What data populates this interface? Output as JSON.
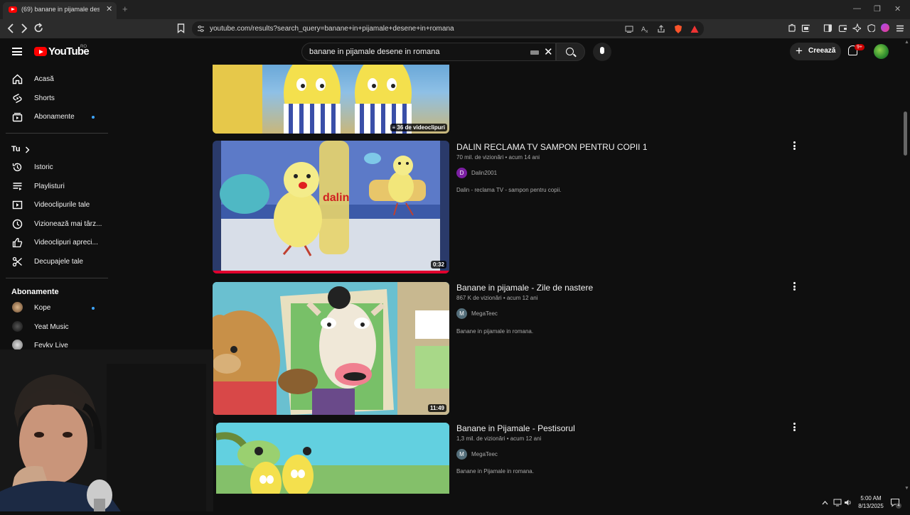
{
  "browser": {
    "tab_title": "(69) banane in pijamale desene...",
    "tab_close": "✕",
    "new_tab": "+",
    "url": "youtube.com/results?search_query=banane+in+pijamale+desene+in+romana",
    "window_controls": [
      "—",
      "❐",
      "✕"
    ]
  },
  "youtube": {
    "logo_text": "YouTube",
    "region": "RO",
    "search_query": "banane in pijamale desene in romana",
    "create_label": "Creează",
    "notif_badge": "9+"
  },
  "sidebar": {
    "main": [
      {
        "label": "Acasă",
        "icon": "home-icon"
      },
      {
        "label": "Shorts",
        "icon": "shorts-icon"
      },
      {
        "label": "Abonamente",
        "icon": "subscriptions-icon",
        "dot": true
      }
    ],
    "you_header": "Tu",
    "you": [
      {
        "label": "Istoric",
        "icon": "history-icon"
      },
      {
        "label": "Playlisturi",
        "icon": "playlists-icon"
      },
      {
        "label": "Videoclipurile tale",
        "icon": "your-videos-icon"
      },
      {
        "label": "Vizionează mai târz...",
        "icon": "watch-later-icon"
      },
      {
        "label": "Videoclipuri apreci...",
        "icon": "liked-icon"
      },
      {
        "label": "Decupajele tale",
        "icon": "clips-icon"
      }
    ],
    "subs_header": "Abonamente",
    "subs": [
      {
        "label": "Kope",
        "dot": true
      },
      {
        "label": "Yeat Music",
        "dot": false
      },
      {
        "label": "Fevkv Live",
        "dot": false
      }
    ]
  },
  "results": [
    {
      "playlist_badge": "36 de videoclipuri"
    },
    {
      "title": "DALIN RECLAMA TV SAMPON PENTRU COPII 1",
      "meta": "70 mil. de vizionări • acum 14 ani",
      "channel": "Dalin2001",
      "channel_initial": "D",
      "desc": "Dalin - reclama TV - sampon pentru copii.",
      "duration": "0:32",
      "thumb_brand": "dalin"
    },
    {
      "title": "Banane in pijamale - Zile de nastere",
      "meta": "867 K de vizionări • acum 12 ani",
      "channel": "MegaTeec",
      "channel_initial": "M",
      "desc": "Banane in pijamale in romana.",
      "duration": "11:49"
    },
    {
      "title": "Banane in Pijamale - Pestisorul",
      "meta": "1,3 mil. de vizionări • acum 12 ani",
      "channel": "MegaTeec",
      "channel_initial": "M",
      "desc": "Banane in Pijamale in romana."
    }
  ],
  "taskbar": {
    "time": "5:00 AM",
    "date": "8/13/2025",
    "notif_count": "4"
  },
  "colors": {
    "yt_red": "#ff0000",
    "bg": "#0f0f0f",
    "accent_blue": "#3ea6ff"
  }
}
